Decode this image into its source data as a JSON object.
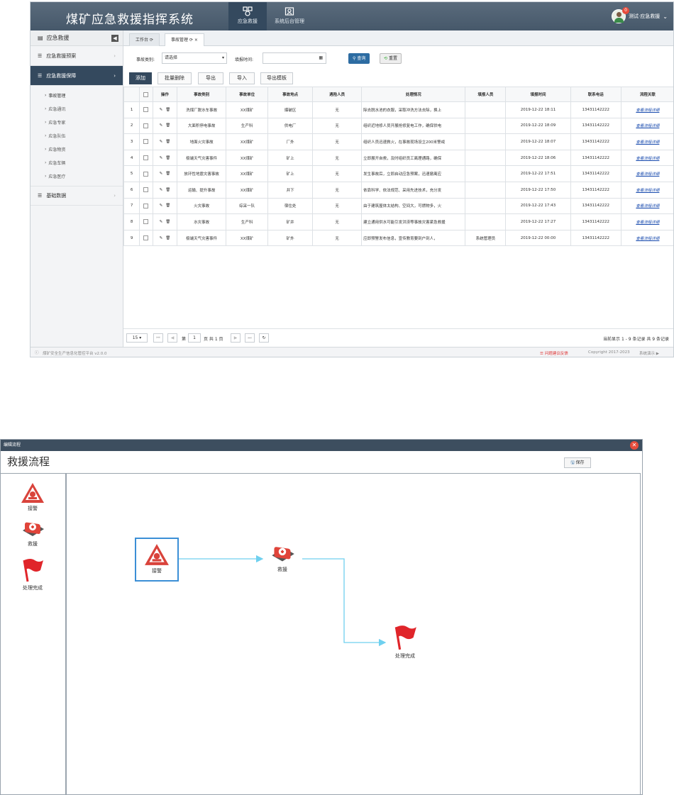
{
  "app": {
    "title": "煤矿应急救援指挥系统",
    "nav": [
      {
        "label": "应急救援"
      },
      {
        "label": "系统后台管理"
      }
    ],
    "user": {
      "name": "测试·应急救援",
      "notifications": "0"
    }
  },
  "sidebar": {
    "header": "应急救援",
    "collapse_icon": "◀",
    "menus": [
      {
        "label": "应急救援预案"
      },
      {
        "label": "应急救援保障"
      },
      {
        "label": "基础数据"
      }
    ],
    "sub_items": [
      "事故管理",
      "应急通讯",
      "应急专家",
      "应急队伍",
      "应急物资",
      "应急车辆",
      "应急医疗"
    ]
  },
  "tabs": [
    {
      "label": "工作台"
    },
    {
      "label": "事故管理"
    }
  ],
  "filters": {
    "type_label": "事故类别:",
    "type_value": "请选择",
    "time_label": "填报时间:",
    "time_value": "",
    "query_label": "查询",
    "reset_label": "重置"
  },
  "toolbar": {
    "add": "添加",
    "batch_delete": "批量删除",
    "export": "导出",
    "import": "导入",
    "export_template": "导出模板"
  },
  "table": {
    "headers": [
      "操作",
      "事故类别",
      "事故单位",
      "事故地点",
      "遇险人员",
      "处理情况",
      "填报人员",
      "填报时间",
      "联系电话",
      "流程关联"
    ],
    "rows": [
      [
        "1",
        "洗煤厂脱水车事故",
        "XX煤矿",
        "爆破区",
        "无",
        "除去脱水池的衣服，采取冲洗方法去除，换上",
        "",
        "2019-12-22 18:11",
        "13431142222",
        "查看流程详细"
      ],
      [
        "2",
        "大面积停电事故",
        "生产科",
        "供电厂",
        "无",
        "组织近地修人员开展抢修复电工作，确保供电",
        "",
        "2019-12-22 18:09",
        "13431142222",
        "查看流程详细"
      ],
      [
        "3",
        "地面火灾事故",
        "XX煤矿",
        "厂外",
        "无",
        "组织人员迅速救火，在事故现场设立200米警戒",
        "",
        "2019-12-22 18:07",
        "13431142222",
        "查看流程详细"
      ],
      [
        "4",
        "极端天气灾害事件",
        "XX煤矿",
        "矿上",
        "无",
        "立即展开自救，及时组织员工离理通路，确保",
        "",
        "2019-12-22 18:06",
        "13431142222",
        "查看流程详细"
      ],
      [
        "5",
        "放环性地震灾害事故",
        "XX煤矿",
        "矿上",
        "无",
        "发生事故后，立即启动应急预案，迅速撤离应",
        "",
        "2019-12-22 17:51",
        "13431142222",
        "查看流程详细"
      ],
      [
        "6",
        "运输、提升事故",
        "XX煤矿",
        "井下",
        "无",
        "依靠科学、依法规范、采用先进技术，充分发",
        "",
        "2019-12-22 17:50",
        "13431142222",
        "查看流程详细"
      ],
      [
        "7",
        "火灾事故",
        "综采一队",
        "宿住处",
        "无",
        "由于建筑屋体太结构、空间大，可燃物多，火",
        "",
        "2019-12-22 17:43",
        "13431142222",
        "查看流程详细"
      ],
      [
        "8",
        "水灾事故",
        "生产科",
        "矿井",
        "无",
        "建立通用供水可能引发洪涝等事故灾害紧急救援",
        "",
        "2019-12-22 17:27",
        "13431142222",
        "查看流程详细"
      ],
      [
        "9",
        "极端天气灾害事件",
        "XX煤矿",
        "矿外",
        "无",
        "应即预警发布信息，宣传教育要到户到人，",
        "系统管理员",
        "2019-12-22 00:00",
        "13431142222",
        "查看流程详细"
      ]
    ]
  },
  "pager": {
    "page_size": "15",
    "page_prefix": "第",
    "page_value": "1",
    "page_suffix": "页 共 1 页",
    "summary": "当前显示 1 - 9 条记录 共 9 条记录"
  },
  "statusbar": {
    "version": "煤矿安全生产信息化管控平台 v2.0.0",
    "feedback": "问题建议反馈",
    "copyright": "Copyright 2017-2023",
    "system": "系统演示"
  },
  "modal": {
    "header": "编辑流程",
    "title": "救援流程",
    "save": "保存",
    "palette": [
      {
        "label": "接警",
        "icon": "alarm-icon"
      },
      {
        "label": "救援",
        "icon": "medkit-icon"
      },
      {
        "label": "处理完成",
        "icon": "flag-icon"
      }
    ],
    "nodes": [
      {
        "label": "接警",
        "icon": "alarm-icon"
      },
      {
        "label": "救援",
        "icon": "medkit-icon"
      },
      {
        "label": "处理完成",
        "icon": "flag-icon"
      }
    ],
    "colors": {
      "accent": "#34495e",
      "link": "#1e4fb0",
      "edge": "#6fd0ef",
      "alarm": "#d9433b",
      "flag": "#e0252a"
    }
  }
}
